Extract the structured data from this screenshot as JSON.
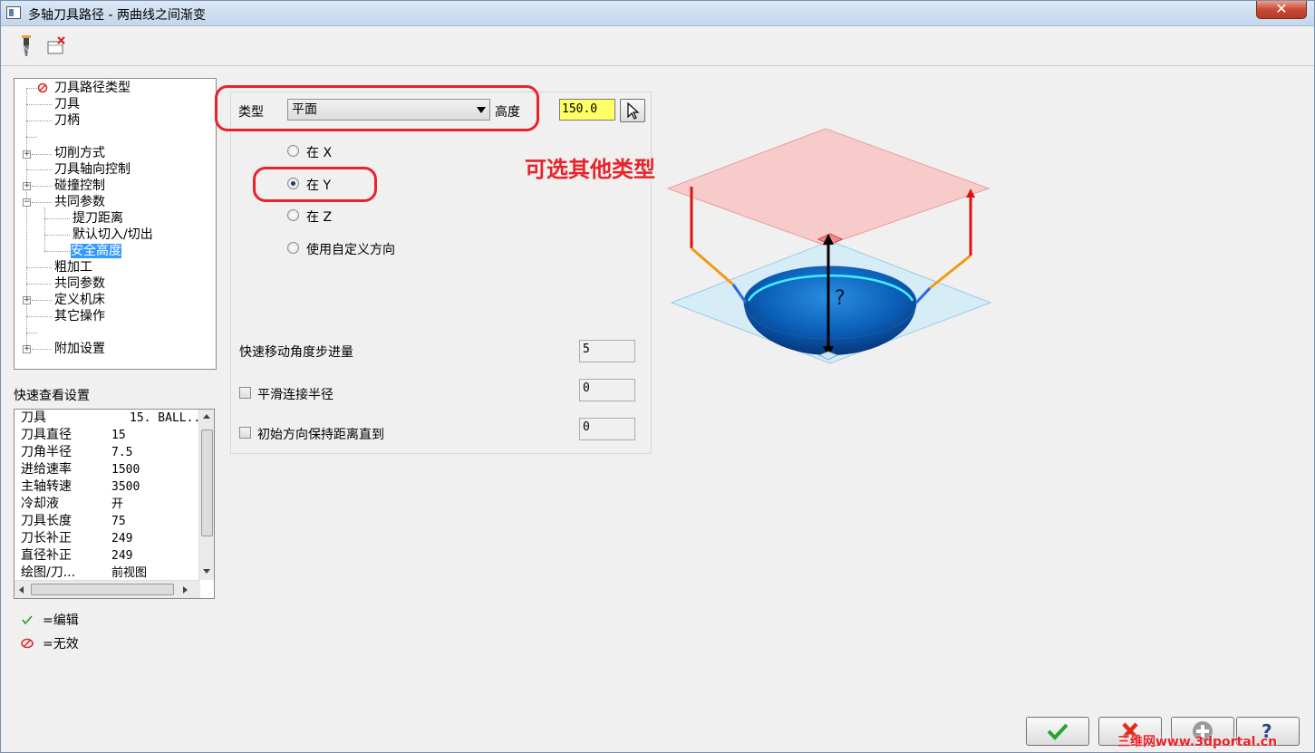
{
  "window": {
    "title": "多轴刀具路径 - 两曲线之间渐变",
    "close_label": "✕"
  },
  "tree": {
    "items": [
      {
        "label": "刀具路径类型",
        "icon": "invalid-icon"
      },
      {
        "label": "刀具"
      },
      {
        "label": "刀柄"
      },
      {
        "label": "切削方式"
      },
      {
        "label": "刀具轴向控制"
      },
      {
        "label": "碰撞控制"
      },
      {
        "label": "共同参数"
      },
      {
        "label": "提刀距离"
      },
      {
        "label": "默认切入/切出"
      },
      {
        "label": "安全高度"
      },
      {
        "label": "粗加工"
      },
      {
        "label": "共同参数"
      },
      {
        "label": "定义机床"
      },
      {
        "label": "其它操作"
      },
      {
        "label": "附加设置"
      }
    ]
  },
  "quickview": {
    "title": "快速查看设置",
    "rows": [
      {
        "k": "刀具",
        "v": "15. BALL.."
      },
      {
        "k": "刀具直径",
        "v": "15"
      },
      {
        "k": "刀角半径",
        "v": "7.5"
      },
      {
        "k": "进给速率",
        "v": "1500"
      },
      {
        "k": "主轴转速",
        "v": "3500"
      },
      {
        "k": "冷却液",
        "v": "开"
      },
      {
        "k": "刀具长度",
        "v": "75"
      },
      {
        "k": "刀长补正",
        "v": "249"
      },
      {
        "k": "直径补正",
        "v": "249"
      },
      {
        "k": "绘图/刀...",
        "v": "前视图"
      }
    ]
  },
  "legend": {
    "edit": "=编辑",
    "invalid": "=无效"
  },
  "form": {
    "type_label": "类型",
    "type_value": "平面",
    "height_label": "高度",
    "height_value": "150.0",
    "radios": [
      {
        "label": "在 X",
        "checked": false
      },
      {
        "label": "在 Y",
        "checked": true
      },
      {
        "label": "在 Z",
        "checked": false
      },
      {
        "label": "使用自定义方向",
        "checked": false
      }
    ],
    "rapid_label": "快速移动角度步进量",
    "rapid_value": "5",
    "smooth_label": "平滑连接半径",
    "smooth_value": "0",
    "keep_label": "初始方向保持距离直到",
    "keep_value": "0"
  },
  "annotation": "可选其他类型",
  "watermark": "三维网www.3dportal.cn",
  "colors": {
    "accent_red": "#e8232a",
    "selection": "#3399ff",
    "height_bg": "#ffff66"
  }
}
